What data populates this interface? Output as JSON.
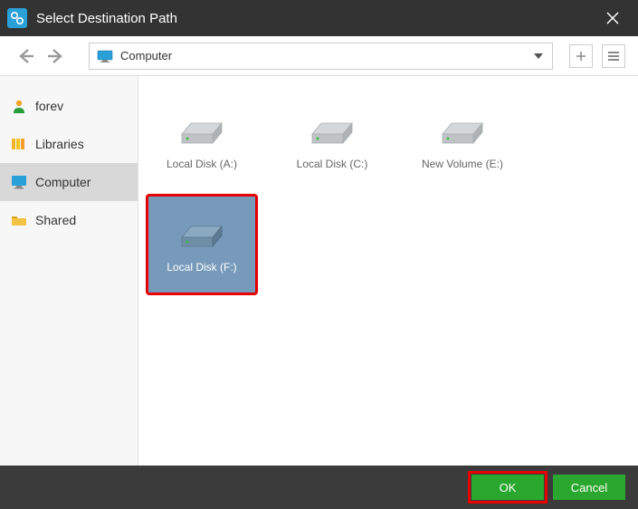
{
  "window": {
    "title": "Select Destination Path"
  },
  "toolbar": {
    "path_label": "Computer"
  },
  "sidebar": {
    "items": [
      {
        "label": "forev"
      },
      {
        "label": "Libraries"
      },
      {
        "label": "Computer"
      },
      {
        "label": "Shared"
      }
    ]
  },
  "drives": [
    {
      "label": "Local Disk (A:)"
    },
    {
      "label": "Local Disk (C:)"
    },
    {
      "label": "New Volume (E:)"
    },
    {
      "label": "Local Disk (F:)"
    }
  ],
  "footer": {
    "ok_label": "OK",
    "cancel_label": "Cancel"
  }
}
